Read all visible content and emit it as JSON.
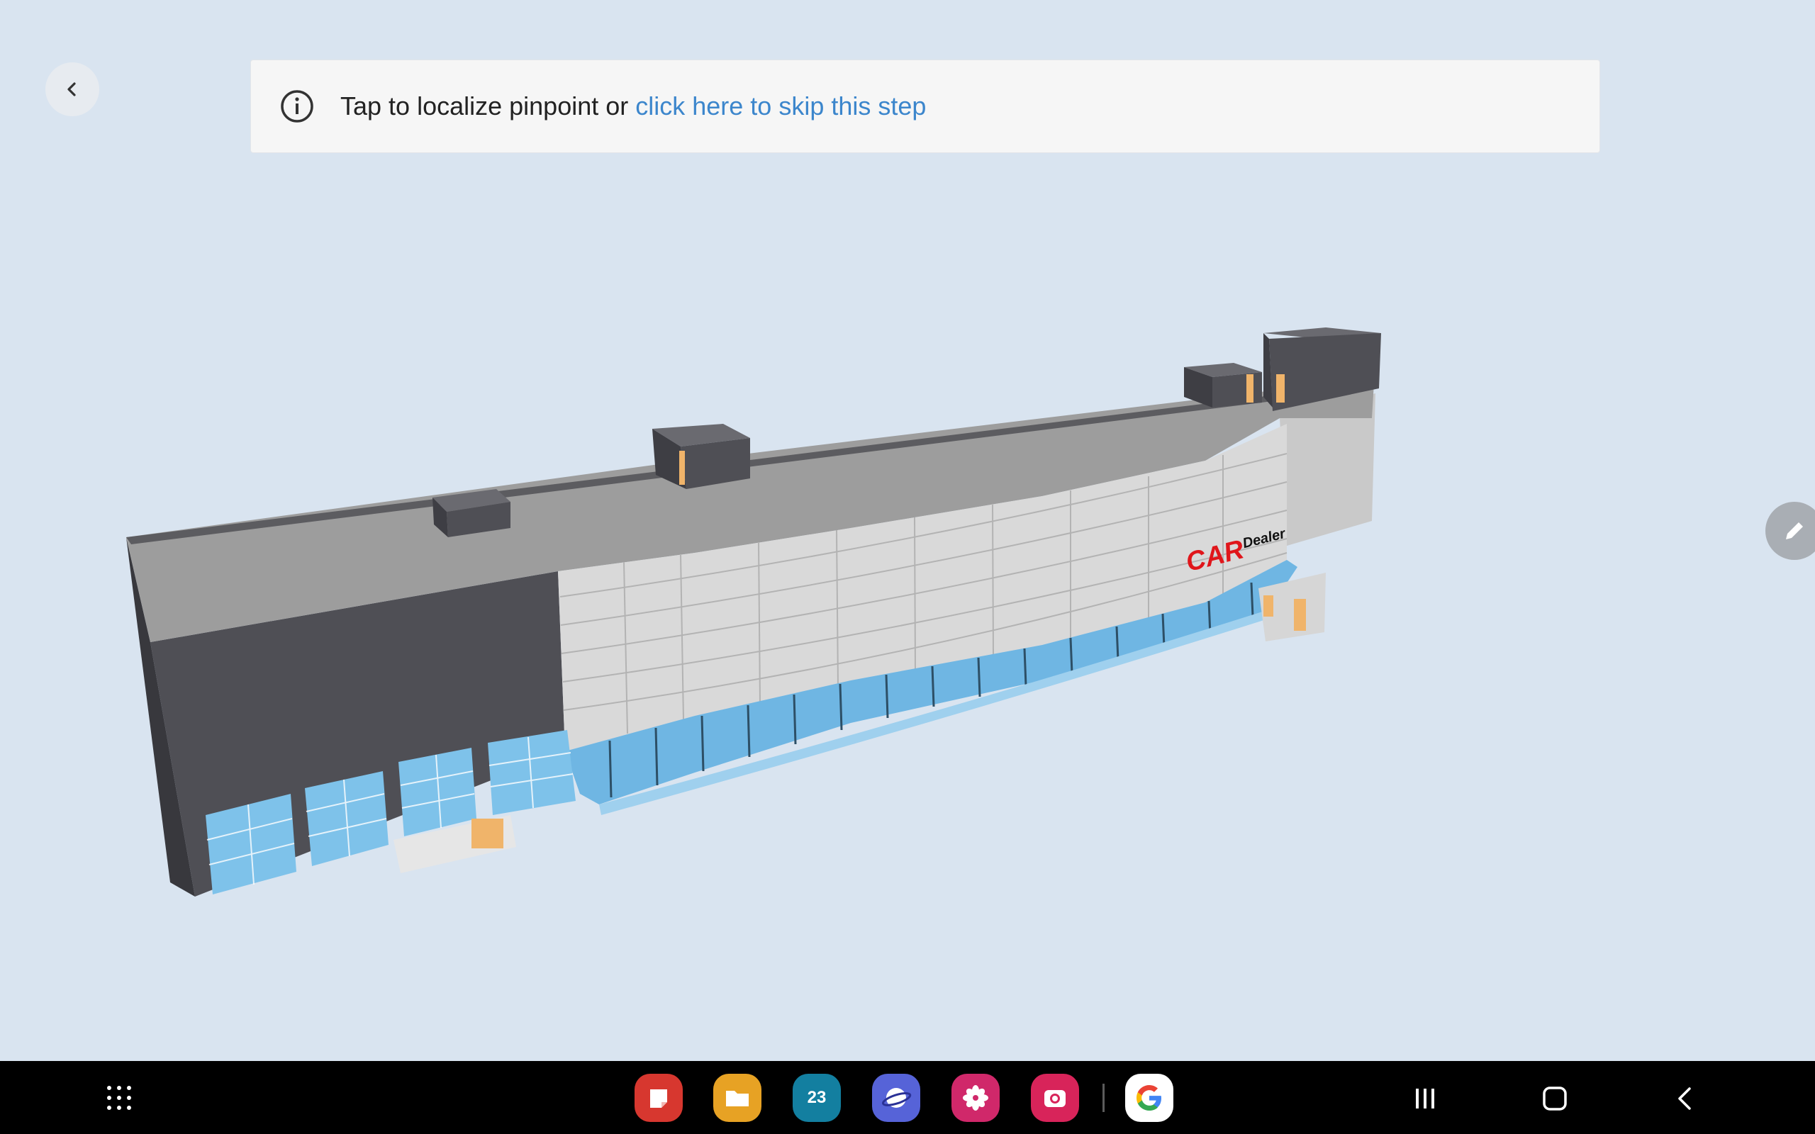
{
  "banner": {
    "text": "Tap to localize pinpoint or ",
    "link": "click here to skip this step"
  },
  "model": {
    "sign_main": "CAR",
    "sign_sub": "Dealer",
    "colors": {
      "background": "#d9e4f0",
      "roof": "#9a9a9a",
      "dark_wall": "#4f4f55",
      "panel_wall": "#d8d8d8",
      "glass": "#6fb6e3",
      "door": "#f0b46a",
      "sign_red": "#e0161b"
    }
  },
  "taskbar": {
    "apps": [
      {
        "name": "notes-app",
        "color": "#d7372f"
      },
      {
        "name": "files-app",
        "color": "#e7a224"
      },
      {
        "name": "calendar-app",
        "color": "#137fa0",
        "label": "23"
      },
      {
        "name": "internet-app",
        "color": "#5663d8"
      },
      {
        "name": "gallery-app",
        "color": "#d0286a"
      },
      {
        "name": "camera-app",
        "color": "#d8245a"
      },
      {
        "name": "google-app",
        "color": "#ffffff"
      }
    ],
    "icons": [
      "apps-grid-icon",
      "recents-icon",
      "home-icon",
      "back-icon"
    ]
  }
}
